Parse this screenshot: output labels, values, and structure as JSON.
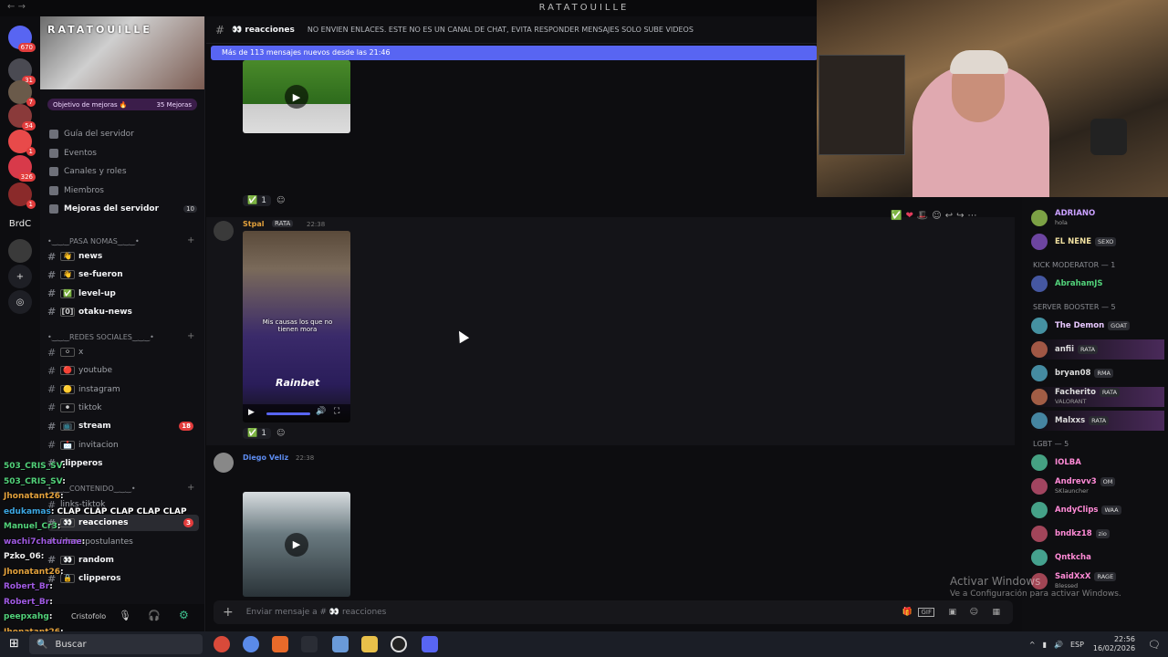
{
  "window": {
    "title": "RATATOUILLE",
    "back_arrow": "←",
    "forward_arrow": "→"
  },
  "servers": [
    {
      "label": "",
      "badge": "670",
      "icon": "discord-home-icon"
    },
    {
      "label": "",
      "badge": "31"
    },
    {
      "label": "",
      "badge": "7"
    },
    {
      "label": "",
      "badge": "54"
    },
    {
      "label": "",
      "badge": "1"
    },
    {
      "label": "",
      "badge": "326"
    },
    {
      "label": "",
      "badge": "1"
    },
    {
      "label": "BrdC",
      "badge": ""
    },
    {
      "label": "",
      "badge": ""
    }
  ],
  "guild": {
    "name": "RATATOUILLE",
    "boost_goal": "Objetivo de mejoras 🔥",
    "boost_count": "35 Mejoras",
    "nav": [
      {
        "label": "Guía del servidor",
        "icon": "book-icon"
      },
      {
        "label": "Eventos",
        "icon": "calendar-icon"
      },
      {
        "label": "Canales y roles",
        "icon": "list-icon"
      },
      {
        "label": "Miembros",
        "icon": "members-icon"
      },
      {
        "label": "Mejoras del servidor",
        "icon": "boost-icon",
        "count": "10"
      }
    ],
    "categories": [
      {
        "label": "•‿‿‿PASA NOMAS‿‿‿•"
      },
      {
        "label": "•‿‿‿REDES SOCIALES‿‿‿•"
      },
      {
        "label": "•‿‿‿CONTENIDO‿‿‿•"
      }
    ],
    "channels_a": [
      {
        "label": "news",
        "em": "👋",
        "bold": true
      },
      {
        "label": "se-fueron",
        "em": "👋",
        "bold": true
      },
      {
        "label": "level-up",
        "em": "✅",
        "bold": true
      },
      {
        "label": "otaku-news",
        "em": "[0]",
        "bold": true
      }
    ],
    "channels_b": [
      {
        "label": "x",
        "em": "⚪",
        "bold": false
      },
      {
        "label": "youtube",
        "em": "🔴",
        "bold": false
      },
      {
        "label": "instagram",
        "em": "🟡",
        "bold": false
      },
      {
        "label": "tiktok",
        "em": "⚫",
        "bold": false
      },
      {
        "label": "stream",
        "em": "📺",
        "bold": true,
        "count": "18"
      },
      {
        "label": "invitacion",
        "em": "📩",
        "bold": false
      },
      {
        "label": "clipperos",
        "em": "",
        "bold": true
      }
    ],
    "channels_c": [
      {
        "label": "links-tiktok",
        "em": "",
        "bold": false
      },
      {
        "label": "reacciones",
        "em": "👀",
        "bold": true,
        "count": "3",
        "selected": true
      },
      {
        "label": "ideas-postulantes",
        "em": "",
        "bold": false
      },
      {
        "label": "random",
        "em": "👀",
        "bold": true
      },
      {
        "label": "clipperos",
        "em": "🔒",
        "bold": true
      }
    ]
  },
  "chat_overlay": [
    {
      "user": "503_CRIS_SV",
      "text": ":",
      "color": "#52d27a"
    },
    {
      "user": "503_CRIS_SV",
      "text": ":",
      "color": "#52d27a"
    },
    {
      "user": "Jhonatant26",
      "text": ":",
      "color": "#e3a13c"
    },
    {
      "user": "edukamas",
      "text": ": CLAP CLAP CLAP CLAP CLAP",
      "color": "#3ca7e3"
    },
    {
      "user": "Manuel_Cr3",
      "text": ":",
      "color": "#52d27a"
    },
    {
      "user": "wachi7chatumae",
      "text": ":",
      "color": "#a05ae3"
    },
    {
      "user": "Pzko_06",
      "text": ":",
      "color": "#eeeeee"
    },
    {
      "user": "Jhonatant26",
      "text": ":",
      "color": "#e3a13c"
    },
    {
      "user": "Robert_Br",
      "text": ":",
      "color": "#a05ae3"
    },
    {
      "user": "Robert_Br",
      "text": ":",
      "color": "#a05ae3"
    },
    {
      "user": "peepxahg",
      "text": ":",
      "color": "#52d27a"
    },
    {
      "user": "Jhonatant26",
      "text": ":",
      "color": "#e3a13c"
    }
  ],
  "userbar": {
    "name": "Cristofolo"
  },
  "header": {
    "channel": "👀 reacciones",
    "topic": "NO ENVIEN ENLACES. ESTE NO ES UN CANAL DE CHAT, EVITA RESPONDER MENSAJES SOLO SUBE VIDEOS"
  },
  "new_messages": "Más de 113 mensajes nuevos desde las 21:46",
  "messages": [
    {
      "user": "",
      "time": "",
      "caption": "",
      "reaction_count": "1"
    },
    {
      "user": "Stpal",
      "role": "RATA",
      "time": "22:38",
      "caption": "Mis causas los que no tienen mora",
      "watermark": "Rainbet",
      "reaction_count": "1"
    },
    {
      "user": "Diego Veliz",
      "role": "",
      "time": "22:38",
      "caption": "",
      "reaction_count": ""
    }
  ],
  "composer": {
    "placeholder": "Enviar mensaje a # 👀 reacciones"
  },
  "members": {
    "top": [
      {
        "name": "ADRIANO",
        "sub": "hola",
        "tag": "",
        "color": "#c9a0ff"
      },
      {
        "name": "EL NENE",
        "sub": "",
        "tag": "SEXO",
        "color": "#f0e0a0"
      }
    ],
    "groups": [
      {
        "label": "KICK MODERATOR — 1",
        "items": [
          {
            "name": "AbrahamJS",
            "sub": "",
            "tag": "",
            "color": "#52d27a"
          }
        ]
      },
      {
        "label": "SERVER BOOSTER — 5",
        "items": [
          {
            "name": "The Demon",
            "sub": "",
            "tag": "GOAT",
            "color": "#e8c8ff"
          },
          {
            "name": "anfii",
            "sub": "",
            "tag": "RATA",
            "color": "#ddd"
          },
          {
            "name": "bryan08",
            "sub": "",
            "tag": "RMA",
            "color": "#ddd"
          },
          {
            "name": "Facherito",
            "sub": "VALORANT",
            "tag": "RATA",
            "color": "#ddd"
          },
          {
            "name": "Malxxs",
            "sub": "",
            "tag": "RATA",
            "color": "#ddd"
          }
        ]
      },
      {
        "label": "LGBT — 5",
        "items": [
          {
            "name": "IOLBA",
            "sub": "",
            "tag": "",
            "color": "#ff8ad6"
          },
          {
            "name": "Andrevv3",
            "sub": "SKlauncher",
            "tag": "OM",
            "color": "#ff8ad6"
          },
          {
            "name": "AndyClips",
            "sub": "",
            "tag": "WAA",
            "color": "#ff8ad6"
          },
          {
            "name": "bndkz18",
            "sub": "",
            "tag": "zio",
            "color": "#ff8ad6"
          },
          {
            "name": "Qntkcha",
            "sub": "",
            "tag": "",
            "color": "#ff8ad6"
          },
          {
            "name": "SaidXxX",
            "sub": "Blessed",
            "tag": "RAGE",
            "color": "#ff8ad6"
          }
        ]
      }
    ]
  },
  "activation": {
    "title": "Activar Windows",
    "sub": "Ve a Configuración para activar Windows."
  },
  "taskbar": {
    "search": "Buscar",
    "lang": "ESP",
    "time": "22:56",
    "date": "16/02/2026"
  },
  "colors": {
    "accent": "#5865f2",
    "mention_red": "#e23c3c"
  }
}
